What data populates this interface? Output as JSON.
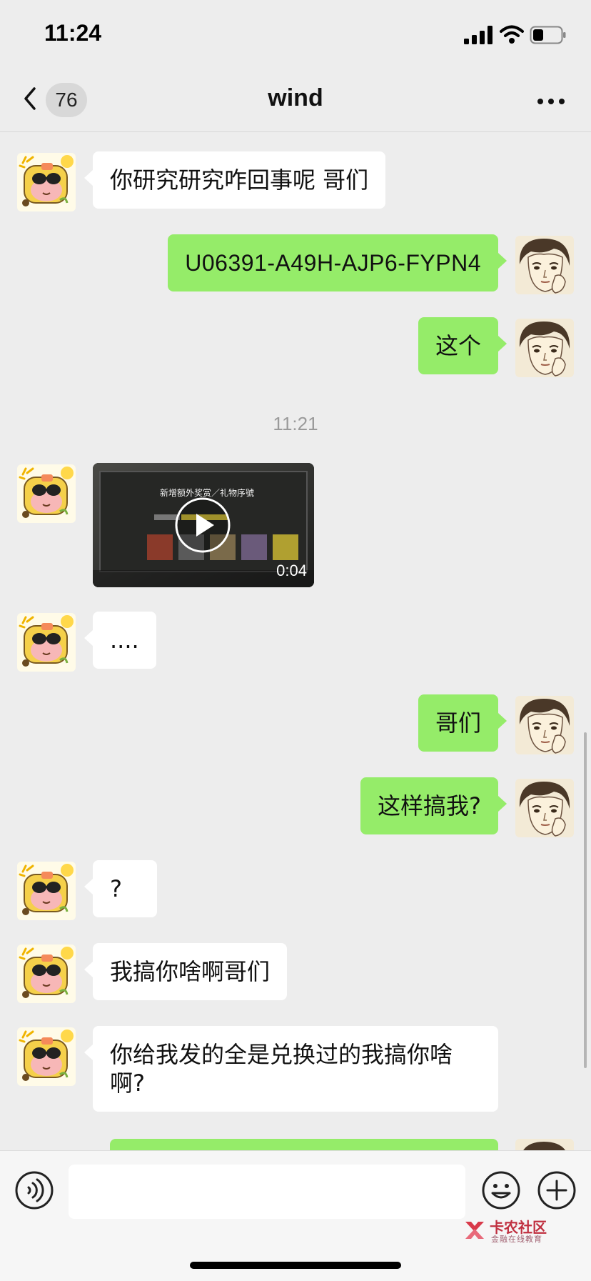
{
  "status": {
    "time": "11:24"
  },
  "nav": {
    "badge": "76",
    "title": "wind"
  },
  "messages": [
    {
      "side": "in",
      "text": "你研究研究咋回事呢 哥们"
    },
    {
      "side": "out",
      "text": "U06391-A49H-AJP6-FYPN4"
    },
    {
      "side": "out",
      "text": "这个"
    },
    {
      "timestamp": "11:21"
    },
    {
      "side": "in",
      "type": "video",
      "duration": "0:04",
      "overlay_title": "新增额外奖赏／礼物序號"
    },
    {
      "side": "in",
      "text": "...."
    },
    {
      "side": "out",
      "text": "哥们"
    },
    {
      "side": "out",
      "text": "这样搞我?"
    },
    {
      "side": "in",
      "text": "?"
    },
    {
      "side": "in",
      "text": "我搞你啥啊哥们"
    },
    {
      "side": "in",
      "text": "你给我发的全是兑换过的我搞你啥啊?"
    }
  ],
  "input": {
    "value": ""
  },
  "watermark": {
    "title": "卡农社区",
    "subtitle": "金融在线教育"
  },
  "colors": {
    "background": "#ededed",
    "incoming_bubble": "#ffffff",
    "outgoing_bubble": "#95ec69"
  }
}
